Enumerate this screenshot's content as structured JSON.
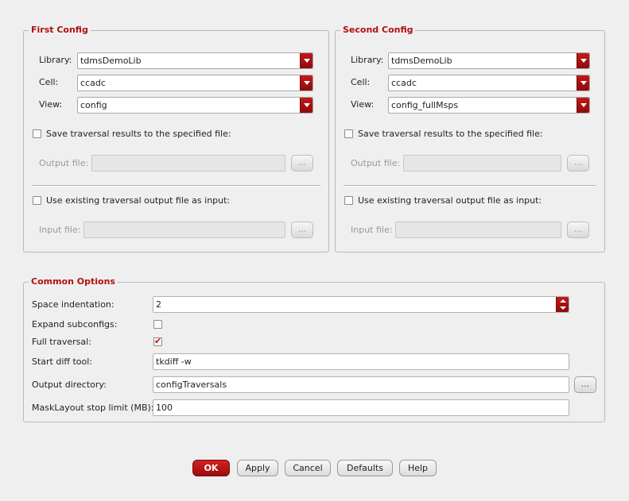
{
  "first_config": {
    "title": "First Config",
    "library_label": "Library:",
    "library_value": "tdmsDemoLib",
    "cell_label": "Cell:",
    "cell_value": "ccadc",
    "view_label": "View:",
    "view_value": "config",
    "save_label": "Save traversal results to the specified file:",
    "save_checked": false,
    "output_label": "Output file:",
    "output_value": "",
    "use_existing_label": "Use existing traversal output file as input:",
    "use_existing_checked": false,
    "input_label": "Input file:",
    "input_value": "",
    "browse_label": "..."
  },
  "second_config": {
    "title": "Second Config",
    "library_label": "Library:",
    "library_value": "tdmsDemoLib",
    "cell_label": "Cell:",
    "cell_value": "ccadc",
    "view_label": "View:",
    "view_value": "config_fullMsps",
    "save_label": "Save traversal results to the specified file:",
    "save_checked": false,
    "output_label": "Output file:",
    "output_value": "",
    "use_existing_label": "Use existing traversal output file as input:",
    "use_existing_checked": false,
    "input_label": "Input file:",
    "input_value": "",
    "browse_label": "..."
  },
  "common_options": {
    "title": "Common Options",
    "space_indent_label": "Space indentation:",
    "space_indent_value": "2",
    "expand_label": "Expand subconfigs:",
    "expand_checked": false,
    "full_traversal_label": "Full traversal:",
    "full_traversal_checked": true,
    "diff_tool_label": "Start diff tool:",
    "diff_tool_value": "tkdiff -w",
    "output_dir_label": "Output directory:",
    "output_dir_value": "configTraversals",
    "browse_label": "...",
    "masklayout_label": "MaskLayout stop limit (MB):",
    "masklayout_value": "100"
  },
  "buttons": {
    "ok": "OK",
    "apply": "Apply",
    "cancel": "Cancel",
    "defaults": "Defaults",
    "help": "Help"
  },
  "colors": {
    "accent": "#b01010",
    "background": "#efefef"
  }
}
